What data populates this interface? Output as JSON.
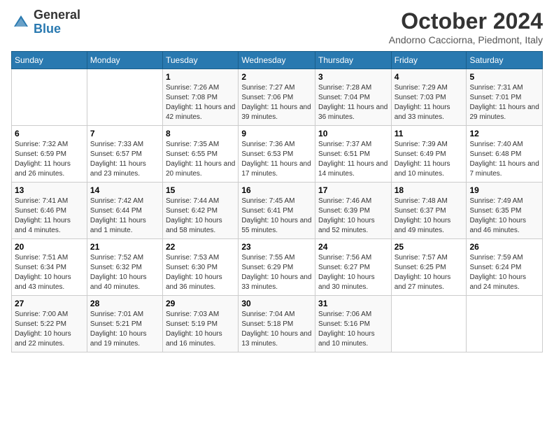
{
  "header": {
    "logo": {
      "general": "General",
      "blue": "Blue"
    },
    "title": "October 2024",
    "subtitle": "Andorno Cacciorna, Piedmont, Italy"
  },
  "weekdays": [
    "Sunday",
    "Monday",
    "Tuesday",
    "Wednesday",
    "Thursday",
    "Friday",
    "Saturday"
  ],
  "weeks": [
    [
      {
        "day": "",
        "sunrise": "",
        "sunset": "",
        "daylight": ""
      },
      {
        "day": "",
        "sunrise": "",
        "sunset": "",
        "daylight": ""
      },
      {
        "day": "1",
        "sunrise": "Sunrise: 7:26 AM",
        "sunset": "Sunset: 7:08 PM",
        "daylight": "Daylight: 11 hours and 42 minutes."
      },
      {
        "day": "2",
        "sunrise": "Sunrise: 7:27 AM",
        "sunset": "Sunset: 7:06 PM",
        "daylight": "Daylight: 11 hours and 39 minutes."
      },
      {
        "day": "3",
        "sunrise": "Sunrise: 7:28 AM",
        "sunset": "Sunset: 7:04 PM",
        "daylight": "Daylight: 11 hours and 36 minutes."
      },
      {
        "day": "4",
        "sunrise": "Sunrise: 7:29 AM",
        "sunset": "Sunset: 7:03 PM",
        "daylight": "Daylight: 11 hours and 33 minutes."
      },
      {
        "day": "5",
        "sunrise": "Sunrise: 7:31 AM",
        "sunset": "Sunset: 7:01 PM",
        "daylight": "Daylight: 11 hours and 29 minutes."
      }
    ],
    [
      {
        "day": "6",
        "sunrise": "Sunrise: 7:32 AM",
        "sunset": "Sunset: 6:59 PM",
        "daylight": "Daylight: 11 hours and 26 minutes."
      },
      {
        "day": "7",
        "sunrise": "Sunrise: 7:33 AM",
        "sunset": "Sunset: 6:57 PM",
        "daylight": "Daylight: 11 hours and 23 minutes."
      },
      {
        "day": "8",
        "sunrise": "Sunrise: 7:35 AM",
        "sunset": "Sunset: 6:55 PM",
        "daylight": "Daylight: 11 hours and 20 minutes."
      },
      {
        "day": "9",
        "sunrise": "Sunrise: 7:36 AM",
        "sunset": "Sunset: 6:53 PM",
        "daylight": "Daylight: 11 hours and 17 minutes."
      },
      {
        "day": "10",
        "sunrise": "Sunrise: 7:37 AM",
        "sunset": "Sunset: 6:51 PM",
        "daylight": "Daylight: 11 hours and 14 minutes."
      },
      {
        "day": "11",
        "sunrise": "Sunrise: 7:39 AM",
        "sunset": "Sunset: 6:49 PM",
        "daylight": "Daylight: 11 hours and 10 minutes."
      },
      {
        "day": "12",
        "sunrise": "Sunrise: 7:40 AM",
        "sunset": "Sunset: 6:48 PM",
        "daylight": "Daylight: 11 hours and 7 minutes."
      }
    ],
    [
      {
        "day": "13",
        "sunrise": "Sunrise: 7:41 AM",
        "sunset": "Sunset: 6:46 PM",
        "daylight": "Daylight: 11 hours and 4 minutes."
      },
      {
        "day": "14",
        "sunrise": "Sunrise: 7:42 AM",
        "sunset": "Sunset: 6:44 PM",
        "daylight": "Daylight: 11 hours and 1 minute."
      },
      {
        "day": "15",
        "sunrise": "Sunrise: 7:44 AM",
        "sunset": "Sunset: 6:42 PM",
        "daylight": "Daylight: 10 hours and 58 minutes."
      },
      {
        "day": "16",
        "sunrise": "Sunrise: 7:45 AM",
        "sunset": "Sunset: 6:41 PM",
        "daylight": "Daylight: 10 hours and 55 minutes."
      },
      {
        "day": "17",
        "sunrise": "Sunrise: 7:46 AM",
        "sunset": "Sunset: 6:39 PM",
        "daylight": "Daylight: 10 hours and 52 minutes."
      },
      {
        "day": "18",
        "sunrise": "Sunrise: 7:48 AM",
        "sunset": "Sunset: 6:37 PM",
        "daylight": "Daylight: 10 hours and 49 minutes."
      },
      {
        "day": "19",
        "sunrise": "Sunrise: 7:49 AM",
        "sunset": "Sunset: 6:35 PM",
        "daylight": "Daylight: 10 hours and 46 minutes."
      }
    ],
    [
      {
        "day": "20",
        "sunrise": "Sunrise: 7:51 AM",
        "sunset": "Sunset: 6:34 PM",
        "daylight": "Daylight: 10 hours and 43 minutes."
      },
      {
        "day": "21",
        "sunrise": "Sunrise: 7:52 AM",
        "sunset": "Sunset: 6:32 PM",
        "daylight": "Daylight: 10 hours and 40 minutes."
      },
      {
        "day": "22",
        "sunrise": "Sunrise: 7:53 AM",
        "sunset": "Sunset: 6:30 PM",
        "daylight": "Daylight: 10 hours and 36 minutes."
      },
      {
        "day": "23",
        "sunrise": "Sunrise: 7:55 AM",
        "sunset": "Sunset: 6:29 PM",
        "daylight": "Daylight: 10 hours and 33 minutes."
      },
      {
        "day": "24",
        "sunrise": "Sunrise: 7:56 AM",
        "sunset": "Sunset: 6:27 PM",
        "daylight": "Daylight: 10 hours and 30 minutes."
      },
      {
        "day": "25",
        "sunrise": "Sunrise: 7:57 AM",
        "sunset": "Sunset: 6:25 PM",
        "daylight": "Daylight: 10 hours and 27 minutes."
      },
      {
        "day": "26",
        "sunrise": "Sunrise: 7:59 AM",
        "sunset": "Sunset: 6:24 PM",
        "daylight": "Daylight: 10 hours and 24 minutes."
      }
    ],
    [
      {
        "day": "27",
        "sunrise": "Sunrise: 7:00 AM",
        "sunset": "Sunset: 5:22 PM",
        "daylight": "Daylight: 10 hours and 22 minutes."
      },
      {
        "day": "28",
        "sunrise": "Sunrise: 7:01 AM",
        "sunset": "Sunset: 5:21 PM",
        "daylight": "Daylight: 10 hours and 19 minutes."
      },
      {
        "day": "29",
        "sunrise": "Sunrise: 7:03 AM",
        "sunset": "Sunset: 5:19 PM",
        "daylight": "Daylight: 10 hours and 16 minutes."
      },
      {
        "day": "30",
        "sunrise": "Sunrise: 7:04 AM",
        "sunset": "Sunset: 5:18 PM",
        "daylight": "Daylight: 10 hours and 13 minutes."
      },
      {
        "day": "31",
        "sunrise": "Sunrise: 7:06 AM",
        "sunset": "Sunset: 5:16 PM",
        "daylight": "Daylight: 10 hours and 10 minutes."
      },
      {
        "day": "",
        "sunrise": "",
        "sunset": "",
        "daylight": ""
      },
      {
        "day": "",
        "sunrise": "",
        "sunset": "",
        "daylight": ""
      }
    ]
  ]
}
